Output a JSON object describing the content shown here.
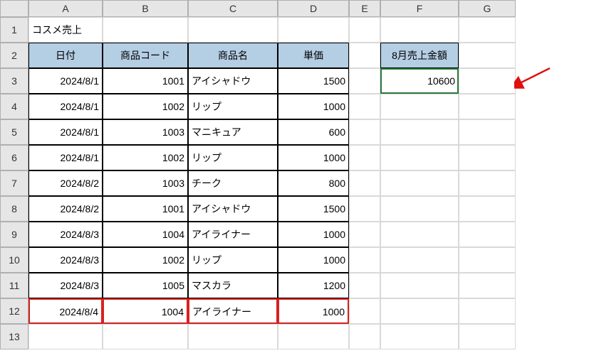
{
  "columns": [
    "A",
    "B",
    "C",
    "D",
    "E",
    "F",
    "G"
  ],
  "rows": [
    "1",
    "2",
    "3",
    "4",
    "5",
    "6",
    "7",
    "8",
    "9",
    "10",
    "11",
    "12",
    "13"
  ],
  "title_cell": "コスメ売上",
  "headers": {
    "date": "日付",
    "product_code": "商品コード",
    "product_name": "商品名",
    "unit_price": "単価",
    "august_sales": "8月売上金額"
  },
  "data_rows": [
    {
      "date": "2024/8/1",
      "code": "1001",
      "name": "アイシャドウ",
      "price": "1500"
    },
    {
      "date": "2024/8/1",
      "code": "1002",
      "name": "リップ",
      "price": "1000"
    },
    {
      "date": "2024/8/1",
      "code": "1003",
      "name": "マニキュア",
      "price": "600"
    },
    {
      "date": "2024/8/1",
      "code": "1002",
      "name": "リップ",
      "price": "1000"
    },
    {
      "date": "2024/8/2",
      "code": "1003",
      "name": "チーク",
      "price": "800"
    },
    {
      "date": "2024/8/2",
      "code": "1001",
      "name": "アイシャドウ",
      "price": "1500"
    },
    {
      "date": "2024/8/3",
      "code": "1004",
      "name": "アイライナー",
      "price": "1000"
    },
    {
      "date": "2024/8/3",
      "code": "1002",
      "name": "リップ",
      "price": "1000"
    },
    {
      "date": "2024/8/3",
      "code": "1005",
      "name": "マスカラ",
      "price": "1200"
    },
    {
      "date": "2024/8/4",
      "code": "1004",
      "name": "アイライナー",
      "price": "1000"
    }
  ],
  "result_value": "10600",
  "chart_data": {
    "type": "table",
    "title": "コスメ売上",
    "columns": [
      "日付",
      "商品コード",
      "商品名",
      "単価"
    ],
    "rows": [
      [
        "2024/8/1",
        1001,
        "アイシャドウ",
        1500
      ],
      [
        "2024/8/1",
        1002,
        "リップ",
        1000
      ],
      [
        "2024/8/1",
        1003,
        "マニキュア",
        600
      ],
      [
        "2024/8/1",
        1002,
        "リップ",
        1000
      ],
      [
        "2024/8/2",
        1003,
        "チーク",
        800
      ],
      [
        "2024/8/2",
        1001,
        "アイシャドウ",
        1500
      ],
      [
        "2024/8/3",
        1004,
        "アイライナー",
        1000
      ],
      [
        "2024/8/3",
        1002,
        "リップ",
        1000
      ],
      [
        "2024/8/3",
        1005,
        "マスカラ",
        1200
      ],
      [
        "2024/8/4",
        1004,
        "アイライナー",
        1000
      ]
    ],
    "summary": {
      "8月売上金額": 10600
    }
  }
}
